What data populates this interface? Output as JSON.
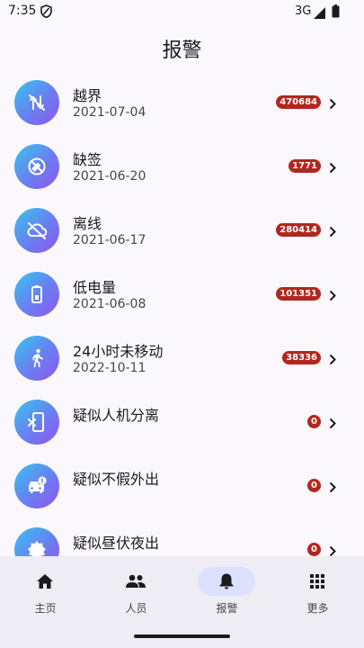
{
  "status_bar": {
    "time": "7:35",
    "network": "3G"
  },
  "header": {
    "title": "报警"
  },
  "alarms": [
    {
      "title": "越界",
      "date": "2021-07-04",
      "count": "470684",
      "icon": "location-off-icon"
    },
    {
      "title": "缺签",
      "date": "2021-06-20",
      "count": "1771",
      "icon": "missed-signin-icon"
    },
    {
      "title": "离线",
      "date": "2021-06-17",
      "count": "280414",
      "icon": "cloud-off-icon"
    },
    {
      "title": "低电量",
      "date": "2021-06-08",
      "count": "101351",
      "icon": "battery-low-icon"
    },
    {
      "title": "24小时未移动",
      "date": "2022-10-11",
      "count": "38336",
      "icon": "walking-person-icon"
    },
    {
      "title": "疑似人机分离",
      "date": "",
      "count": "0",
      "icon": "device-separation-icon"
    },
    {
      "title": "疑似不假外出",
      "date": "",
      "count": "0",
      "icon": "car-alert-icon"
    },
    {
      "title": "疑似昼伏夜出",
      "date": "",
      "count": "0",
      "icon": "day-night-icon"
    }
  ],
  "nav": [
    {
      "label": "主页",
      "icon": "home-icon"
    },
    {
      "label": "人员",
      "icon": "people-icon"
    },
    {
      "label": "报警",
      "icon": "bell-icon",
      "active": true
    },
    {
      "label": "更多",
      "icon": "apps-grid-icon"
    }
  ],
  "colors": {
    "badge": "#b3261e",
    "nav_active_pill": "#dbe1ff",
    "icon_gradient": [
      "#36c6ef",
      "#8e58ef"
    ]
  }
}
